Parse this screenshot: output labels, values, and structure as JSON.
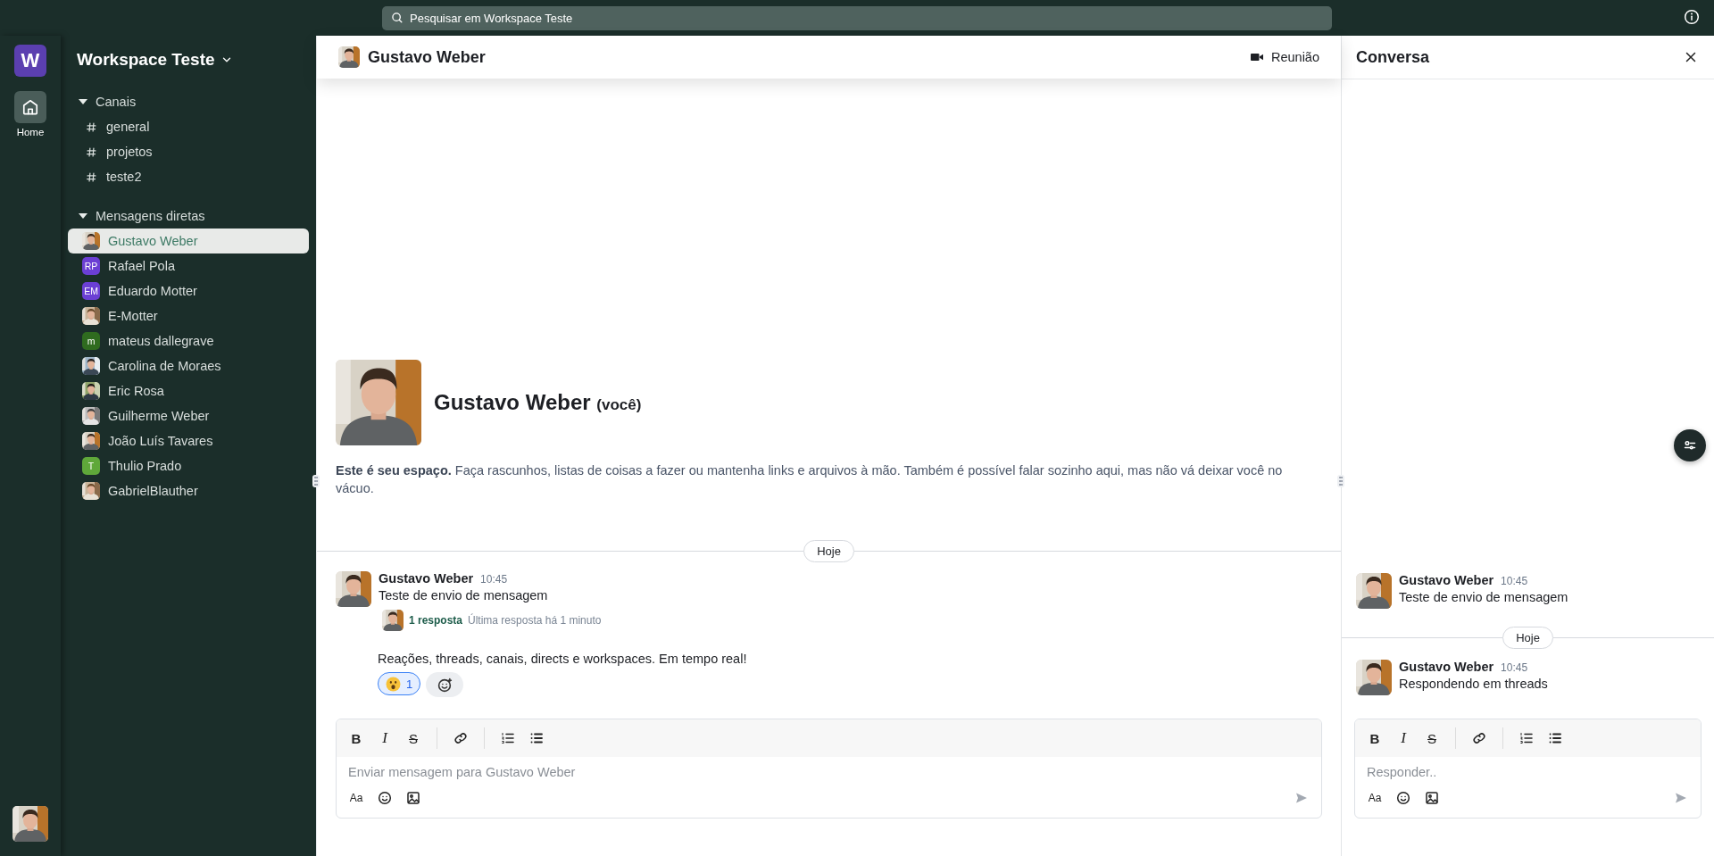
{
  "topbar": {
    "search_placeholder": "Pesquisar em Workspace Teste"
  },
  "rail": {
    "workspace_initial": "W",
    "items": [
      {
        "label": "Home",
        "selected": true
      }
    ]
  },
  "sidebar": {
    "workspace_name": "Workspace Teste",
    "sections": [
      {
        "title": "Canais",
        "expanded": true,
        "items": [
          {
            "kind": "channel",
            "label": "general",
            "selected": false
          },
          {
            "kind": "channel",
            "label": "projetos",
            "selected": false
          },
          {
            "kind": "channel",
            "label": "teste2",
            "selected": false
          }
        ]
      },
      {
        "title": "Mensagens diretas",
        "expanded": true,
        "items": [
          {
            "label": "Gustavo Weber",
            "selected": true
          },
          {
            "kind": "initials",
            "initials": "RP",
            "color": "#6b3fd4",
            "label": "Rafael Pola",
            "selected": false
          },
          {
            "kind": "initials",
            "initials": "EM",
            "color": "#6b3fd4",
            "label": "Eduardo Motter",
            "selected": false
          },
          {
            "label": "E-Motter",
            "selected": false
          },
          {
            "kind": "initials",
            "initials": "m",
            "color": "#2f6b1f",
            "label": "mateus dallegrave",
            "selected": false
          },
          {
            "label": "Carolina de Moraes",
            "selected": false
          },
          {
            "label": "Eric Rosa",
            "selected": false
          },
          {
            "label": "Guilherme Weber",
            "selected": false
          },
          {
            "label": "João Luís Tavares",
            "selected": false
          },
          {
            "kind": "initials",
            "initials": "T",
            "color": "#5fa83a",
            "label": "Thulio Prado",
            "selected": false
          },
          {
            "label": "GabrielBlauther",
            "selected": false
          }
        ]
      }
    ]
  },
  "chat": {
    "title": "Gustavo Weber",
    "meeting_button": "Reunião",
    "intro": {
      "name": "Gustavo Weber",
      "suffix": "(você)",
      "text": "**Este é seu espaço.** Faça rascunhos, listas de coisas a fazer ou mantenha links e arquivos à mão. Também é possível falar sozinho aqui, mas não vá deixar você no vácuo."
    },
    "date_divider": "Hoje",
    "messages": [
      {
        "kind": "full",
        "author": "Gustavo Weber",
        "time": "10:45",
        "text": "Teste de envio de mensagem",
        "thread": {
          "count": "1 resposta",
          "last": "Última resposta há 1 minuto"
        }
      },
      {
        "kind": "continuation",
        "text": "Reações, threads, canais, directs e workspaces. Em tempo real!",
        "reactions": [
          {
            "count": "1",
            "selected": true
          }
        ]
      }
    ],
    "composer": {
      "toolbar": [
        "B",
        "I",
        "S"
      ],
      "text_style": "Aa",
      "placeholder": "Enviar mensagem para Gustavo Weber"
    }
  },
  "thread_panel": {
    "title": "Conversa",
    "root": {
      "author": "Gustavo Weber",
      "time": "10:45",
      "text": "Teste de envio de mensagem"
    },
    "date_divider": "Hoje",
    "replies": [
      {
        "author": "Gustavo Weber",
        "time": "10:45",
        "text": "Respondendo em threads"
      }
    ],
    "composer": {
      "toolbar": [
        "B",
        "I",
        "S"
      ],
      "text_style": "Aa",
      "placeholder": "Responder.."
    }
  }
}
